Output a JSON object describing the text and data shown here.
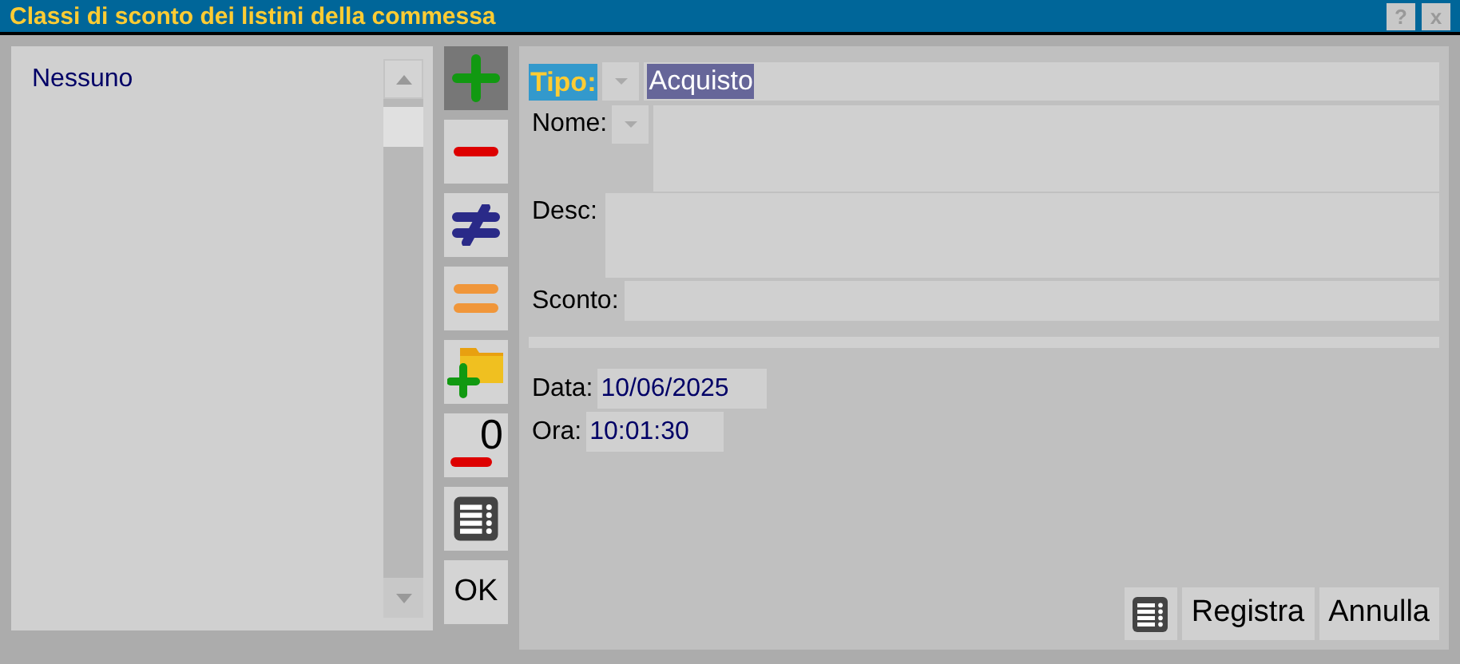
{
  "window": {
    "title": "Classi di sconto dei listini della commessa",
    "help": "?",
    "close": "x"
  },
  "list": {
    "items": [
      {
        "label": "Nessuno"
      }
    ]
  },
  "toolbar": [
    {
      "kind": "add",
      "selected": true
    },
    {
      "kind": "remove",
      "selected": false
    },
    {
      "kind": "not-equal",
      "selected": false
    },
    {
      "kind": "equal",
      "selected": false
    },
    {
      "kind": "folder-add",
      "selected": false
    },
    {
      "kind": "zero",
      "selected": false,
      "label": "0"
    },
    {
      "kind": "list",
      "selected": false
    },
    {
      "kind": "text",
      "selected": false,
      "label": "OK"
    }
  ],
  "form": {
    "tipo": {
      "label": "Tipo:",
      "value": "Acquisto"
    },
    "nome": {
      "label": "Nome:"
    },
    "desc": {
      "label": "Desc:"
    },
    "sconto": {
      "label": "Sconto:"
    },
    "data": {
      "label": "Data:",
      "value": "10/06/2025"
    },
    "ora": {
      "label": "Ora:",
      "value": "10:01:30"
    }
  },
  "buttons": [
    {
      "label": "Registra"
    },
    {
      "label": "Annulla"
    }
  ]
}
